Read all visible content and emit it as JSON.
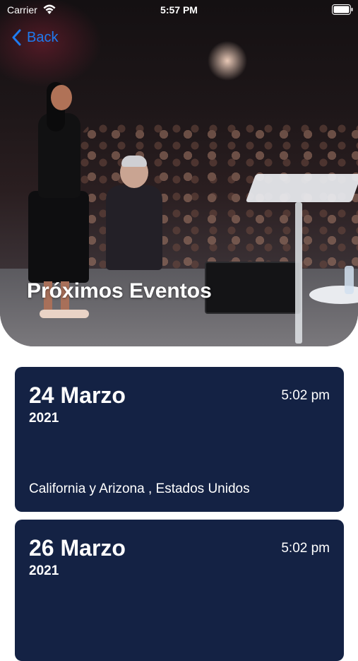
{
  "status_bar": {
    "carrier": "Carrier",
    "time": "5:57 PM"
  },
  "nav": {
    "back_label": "Back"
  },
  "hero": {
    "title": "Próximos Eventos"
  },
  "events": [
    {
      "date": "24 Marzo",
      "year": "2021",
      "time": "5:02 pm",
      "location": "California y Arizona , Estados Unidos"
    },
    {
      "date": "26 Marzo",
      "year": "2021",
      "time": "5:02 pm",
      "location": ""
    }
  ],
  "colors": {
    "accent": "#1e7bf0",
    "card_background": "#142244",
    "text_on_card": "#ffffff"
  },
  "icons": [
    "wifi-icon",
    "battery-icon",
    "chevron-left-icon"
  ]
}
